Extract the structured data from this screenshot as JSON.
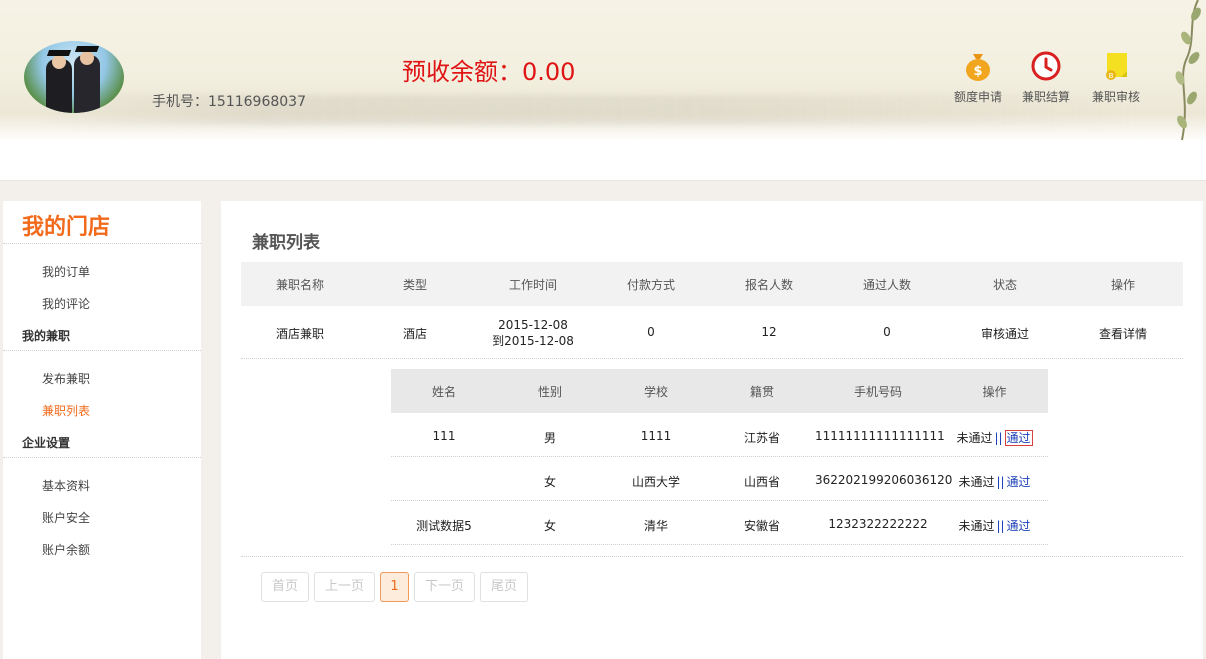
{
  "header": {
    "phone_label": "手机号：15116968037",
    "balance_label": "预收余额：0.00",
    "icons": [
      {
        "name": "money-bag-icon",
        "label": "额度申请",
        "color": "#f0a020"
      },
      {
        "name": "clock-icon",
        "label": "兼职结算",
        "color": "#d82020"
      },
      {
        "name": "sticky-note-icon",
        "label": "兼职审核",
        "color": "#f4e020"
      }
    ]
  },
  "sidebar": {
    "title": "我的门店",
    "items": [
      {
        "label": "我的订单"
      },
      {
        "label": "我的评论"
      },
      {
        "group": "我的兼职"
      },
      {
        "label": "发布兼职"
      },
      {
        "label": "兼职列表",
        "active": true
      },
      {
        "group": "企业设置"
      },
      {
        "label": "基本资料"
      },
      {
        "label": "账户安全"
      },
      {
        "label": "账户余额"
      }
    ]
  },
  "main": {
    "title": "兼职列表",
    "job_table": {
      "headers": [
        "兼职名称",
        "类型",
        "工作时间",
        "付款方式",
        "报名人数",
        "通过人数",
        "状态",
        "操作"
      ],
      "row": {
        "name": "酒店兼职",
        "type": "酒店",
        "time_start": "2015-12-08",
        "time_end": "到2015-12-08",
        "payment": "0",
        "signups": "12",
        "passed": "0",
        "status": "审核通过",
        "action": "查看详情"
      }
    },
    "applicant_table": {
      "headers": [
        "姓名",
        "性别",
        "学校",
        "籍贯",
        "手机号码",
        "操作"
      ],
      "rows": [
        {
          "name": "111",
          "gender": "男",
          "school": "1111",
          "origin": "江苏省",
          "phone": "11111111111111111",
          "reject": "未通过",
          "sep": "||",
          "pass": "通过"
        },
        {
          "name": "",
          "gender": "女",
          "school": "山西大学",
          "origin": "山西省",
          "phone": "362202199206036120",
          "reject": "未通过",
          "sep": "||",
          "pass": "通过"
        },
        {
          "name": "测试数据5",
          "gender": "女",
          "school": "清华",
          "origin": "安徽省",
          "phone": "1232322222222",
          "reject": "未通过",
          "sep": "||",
          "pass": "通过"
        }
      ]
    },
    "pagination": {
      "first": "首页",
      "prev": "上一页",
      "current": "1",
      "next": "下一页",
      "last": "尾页"
    }
  }
}
